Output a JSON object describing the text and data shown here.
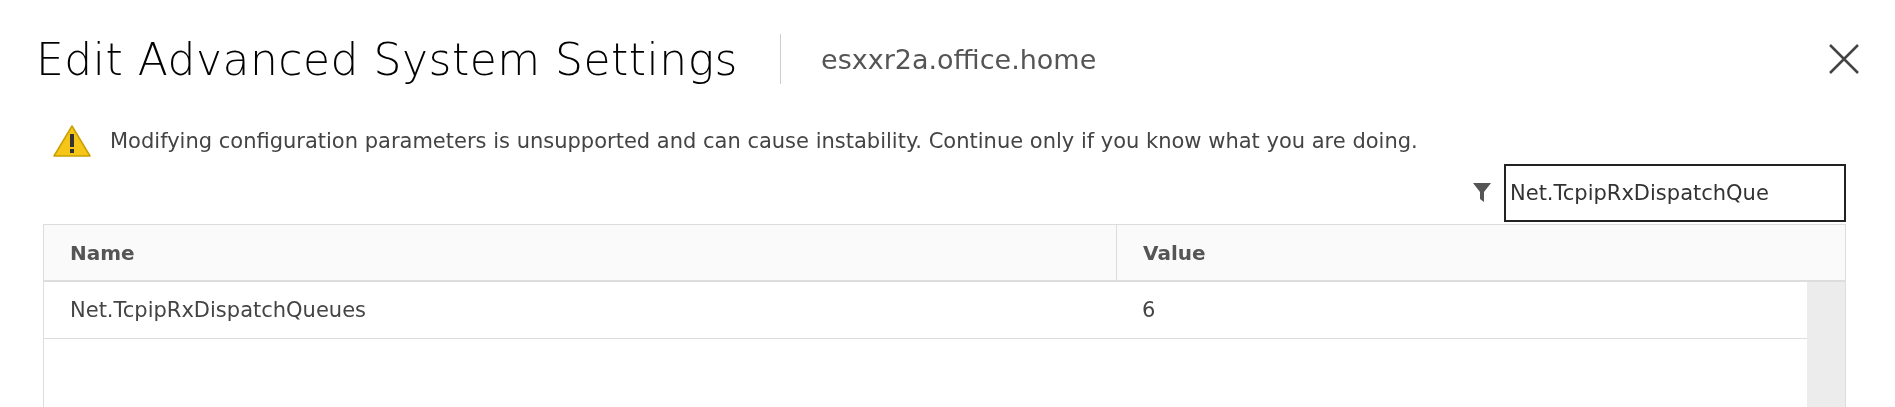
{
  "dialog": {
    "title": "Edit Advanced System Settings",
    "host": "esxxr2a.office.home"
  },
  "warning": "Modifying configuration parameters is unsupported and can cause instability. Continue only if you know what you are doing.",
  "filter": {
    "value": "Net.TcpipRxDispatchQue"
  },
  "table": {
    "columns": [
      "Name",
      "Value"
    ],
    "rows": [
      {
        "name": "Net.TcpipRxDispatchQueues",
        "value": "6"
      }
    ]
  }
}
